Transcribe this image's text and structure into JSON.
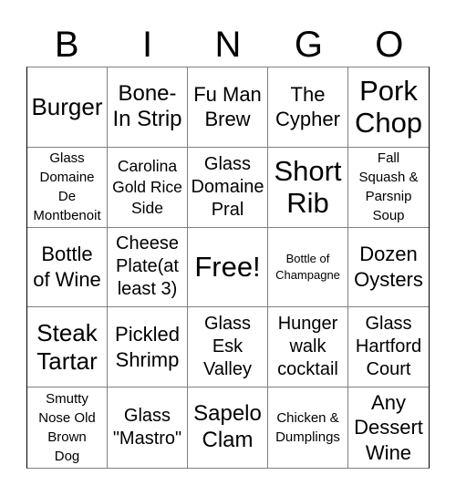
{
  "header": {
    "letters": [
      "B",
      "I",
      "N",
      "G",
      "O"
    ]
  },
  "cells": [
    {
      "text": "Burger"
    },
    {
      "text": "Bone-\nIn Strip"
    },
    {
      "text": "Fu Man\nBrew"
    },
    {
      "text": "The\nCypher"
    },
    {
      "text": "Pork\nChop"
    },
    {
      "text": "Glass\nDomaine\nDe\nMontbenoit"
    },
    {
      "text": "Carolina\nGold Rice\nSide"
    },
    {
      "text": "Glass\nDomaine\nPral"
    },
    {
      "text": "Short\nRib"
    },
    {
      "text": "Fall\nSquash &\nParsnip\nSoup"
    },
    {
      "text": "Bottle\nof Wine"
    },
    {
      "text": "Cheese\nPlate(at\nleast 3)"
    },
    {
      "text": "Free!"
    },
    {
      "text": "Bottle of\nChampagne"
    },
    {
      "text": "Dozen\nOysters"
    },
    {
      "text": "Steak\nTartar"
    },
    {
      "text": "Pickled\nShrimp"
    },
    {
      "text": "Glass\nEsk\nValley"
    },
    {
      "text": "Hunger\nwalk\ncocktail"
    },
    {
      "text": "Glass\nHartford\nCourt"
    },
    {
      "text": "Smutty\nNose Old\nBrown\nDog"
    },
    {
      "text": "Glass\n\"Mastro\""
    },
    {
      "text": "Sapelo\nClam"
    },
    {
      "text": "Chicken &\nDumplings"
    },
    {
      "text": "Any\nDessert\nWine"
    }
  ]
}
